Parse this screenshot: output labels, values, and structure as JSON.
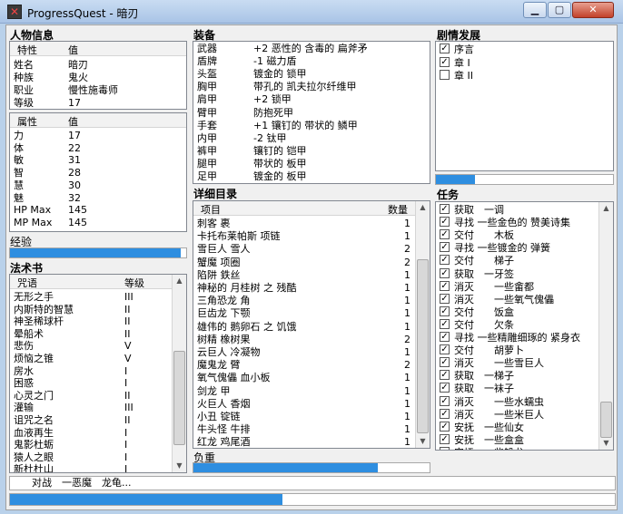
{
  "window": {
    "title": "ProgressQuest - 暗刃",
    "icon": "sword-app-icon"
  },
  "character": {
    "header": "人物信息",
    "col_trait": "特性",
    "col_value": "值",
    "traits": [
      {
        "k": "姓名",
        "v": "暗刃"
      },
      {
        "k": "种族",
        "v": "鬼火"
      },
      {
        "k": "职业",
        "v": "慢性施毒师"
      },
      {
        "k": "等级",
        "v": "17"
      }
    ],
    "col_attr": "属性",
    "col_attr_value": "值",
    "stats": [
      {
        "k": "力",
        "v": "17"
      },
      {
        "k": "体",
        "v": "22"
      },
      {
        "k": "敏",
        "v": "31"
      },
      {
        "k": "智",
        "v": "28"
      },
      {
        "k": "慧",
        "v": "30"
      },
      {
        "k": "魅",
        "v": "32"
      },
      {
        "k": "HP Max",
        "v": "145"
      },
      {
        "k": "MP Max",
        "v": "145"
      }
    ],
    "experience_label": "经验",
    "experience_progress": 0.97
  },
  "spells": {
    "header": "法术书",
    "col_spell": "咒语",
    "col_level": "等级",
    "items": [
      {
        "k": "无形之手",
        "v": "III"
      },
      {
        "k": "内斯特的智慧",
        "v": "II"
      },
      {
        "k": "神圣稀球杆",
        "v": "II"
      },
      {
        "k": "晕船术",
        "v": "II"
      },
      {
        "k": "悲伤",
        "v": "V"
      },
      {
        "k": "烦恼之锥",
        "v": "V"
      },
      {
        "k": "房水",
        "v": "I"
      },
      {
        "k": "困惑",
        "v": "I"
      },
      {
        "k": "心灵之门",
        "v": "II"
      },
      {
        "k": "灌输",
        "v": "III"
      },
      {
        "k": "诅咒之名",
        "v": "II"
      },
      {
        "k": "血液再生",
        "v": "I"
      },
      {
        "k": "鬼影杜蛎",
        "v": "I"
      },
      {
        "k": "猿人之眼",
        "v": "I"
      },
      {
        "k": "新杜杜山",
        "v": "I"
      }
    ]
  },
  "equipment": {
    "header": "装备",
    "items": [
      {
        "k": "武器",
        "v": "+2 恶性的 含毒的 扁斧矛"
      },
      {
        "k": "盾牌",
        "v": "-1 磁力盾"
      },
      {
        "k": "头盔",
        "v": "镀金的 锁甲"
      },
      {
        "k": "胸甲",
        "v": "带孔的 凯夫拉尔纤维甲"
      },
      {
        "k": "肩甲",
        "v": "+2 锁甲"
      },
      {
        "k": "臂甲",
        "v": "防抱死甲"
      },
      {
        "k": "手套",
        "v": "+1 镶钉的 带状的 鳞甲"
      },
      {
        "k": "内甲",
        "v": "-2 钛甲"
      },
      {
        "k": "裤甲",
        "v": "镶钉的 铠甲"
      },
      {
        "k": "腿甲",
        "v": "带状的 板甲"
      },
      {
        "k": "足甲",
        "v": "镀金的 板甲"
      }
    ]
  },
  "inventory": {
    "header": "详细目录",
    "col_item": "项目",
    "col_qty": "数量",
    "items": [
      {
        "k": "刺客 裹",
        "v": "1"
      },
      {
        "k": "卡托布莱帕斯 项链",
        "v": "1"
      },
      {
        "k": "雪巨人 雪人",
        "v": "2"
      },
      {
        "k": "蟹魔 项圈",
        "v": "2"
      },
      {
        "k": "陷阱 鉄丝",
        "v": "1"
      },
      {
        "k": "神秘的 月桂树 之 残酷",
        "v": "1"
      },
      {
        "k": "三角恐龙 角",
        "v": "1"
      },
      {
        "k": "巨齿龙 下颚",
        "v": "1"
      },
      {
        "k": "雄伟的 鹅卵石 之 饥饿",
        "v": "1"
      },
      {
        "k": "树精 橡树果",
        "v": "2"
      },
      {
        "k": "云巨人 冷凝物",
        "v": "1"
      },
      {
        "k": "魔鬼龙 臂",
        "v": "2"
      },
      {
        "k": "氧气傀儡 血小板",
        "v": "1"
      },
      {
        "k": "剑龙 甲",
        "v": "1"
      },
      {
        "k": "火巨人 香烟",
        "v": "1"
      },
      {
        "k": "小丑 锭链",
        "v": "1"
      },
      {
        "k": "牛头怪 牛排",
        "v": "1"
      },
      {
        "k": "红龙 鸡尾酒",
        "v": "1"
      }
    ],
    "encumbrance_label": "负重",
    "encumbrance_progress": 0.78
  },
  "plot": {
    "header": "剧情发展",
    "items": [
      {
        "label": "序言",
        "checked": true
      },
      {
        "label": "章 I",
        "checked": true
      },
      {
        "label": "章 II",
        "checked": false
      }
    ],
    "progress": 0.22
  },
  "quests": {
    "header": "任务",
    "items": [
      {
        "label": "获取　一调",
        "checked": true
      },
      {
        "label": "寻找 一些金色的 赞美诗集",
        "checked": true
      },
      {
        "label": "交付　　木板",
        "checked": true
      },
      {
        "label": "寻找 一些镀金的 弹簧",
        "checked": true
      },
      {
        "label": "交付　　梯子",
        "checked": true
      },
      {
        "label": "获取　一牙签",
        "checked": true
      },
      {
        "label": "消灭　　一些畲都",
        "checked": true
      },
      {
        "label": "消灭　　一些氧气傀儡",
        "checked": true
      },
      {
        "label": "交付　　饭盒",
        "checked": true
      },
      {
        "label": "交付　　欠条",
        "checked": true
      },
      {
        "label": "寻找 一些精雕细琢的 紧身衣",
        "checked": true
      },
      {
        "label": "交付　　胡萝卜",
        "checked": true
      },
      {
        "label": "消灭　　一些雪巨人",
        "checked": true
      },
      {
        "label": "获取　一梯子",
        "checked": true
      },
      {
        "label": "获取　一袜子",
        "checked": true
      },
      {
        "label": "消灭　　一些水蠕虫",
        "checked": true
      },
      {
        "label": "消灭　　一些米巨人",
        "checked": true
      },
      {
        "label": "安抚　一些仙女",
        "checked": true
      },
      {
        "label": "安抚　一些盒盒",
        "checked": true
      },
      {
        "label": "安抚　一些铅龙",
        "checked": false
      }
    ]
  },
  "status": {
    "text": "对战　一恶魔　龙龟...",
    "progress": 0.45
  },
  "colors": {
    "progress_fill": "#2e8ee0",
    "window_frame": "#b9d1ea"
  }
}
